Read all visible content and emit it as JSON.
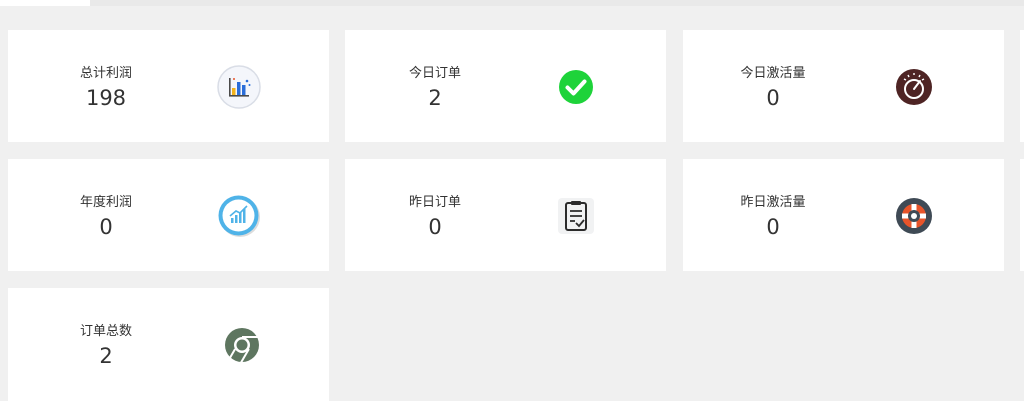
{
  "stats": [
    {
      "label": "总计利润",
      "value": "198",
      "icon": "bar-chart-icon"
    },
    {
      "label": "今日订单",
      "value": "2",
      "icon": "check-circle-icon"
    },
    {
      "label": "今日激活量",
      "value": "0",
      "icon": "speedometer-icon"
    },
    {
      "label": "年度利润",
      "value": "0",
      "icon": "trend-chart-icon"
    },
    {
      "label": "昨日订单",
      "value": "0",
      "icon": "clipboard-check-icon"
    },
    {
      "label": "昨日激活量",
      "value": "0",
      "icon": "lifebuoy-icon"
    },
    {
      "label": "订单总数",
      "value": "2",
      "icon": "chrome-icon"
    }
  ],
  "colors": {
    "background": "#f0f0f0",
    "card": "#ffffff",
    "check_green": "#1ed33a",
    "speedometer_brown": "#4e2424",
    "lifebuoy_dark": "#3f4a55",
    "lifebuoy_orange": "#e8542a",
    "chrome_green": "#5e7660"
  }
}
